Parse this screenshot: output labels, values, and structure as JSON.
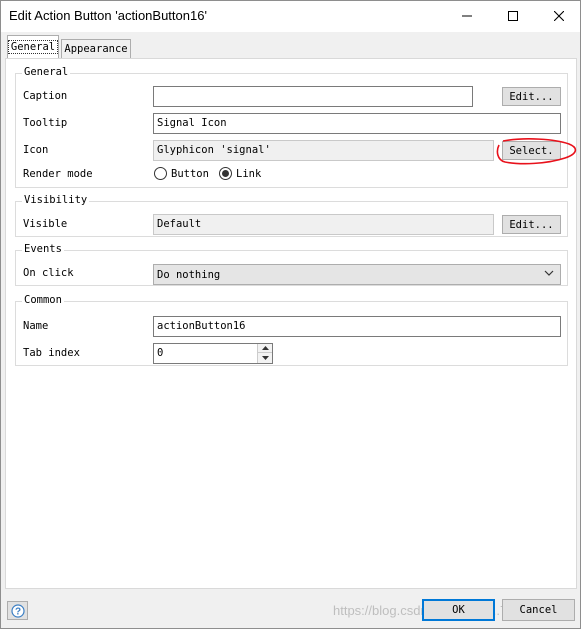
{
  "window": {
    "title": "Edit Action Button 'actionButton16'",
    "controls": [
      "minimize-icon",
      "maximize-icon",
      "close-icon"
    ]
  },
  "tabs": [
    {
      "label": "General",
      "active": true
    },
    {
      "label": "Appearance",
      "active": false
    }
  ],
  "general": {
    "title": "General",
    "caption_label": "Caption",
    "caption_value": "",
    "caption_button": "Edit...",
    "tooltip_label": "Tooltip",
    "tooltip_value": "Signal Icon",
    "icon_label": "Icon",
    "icon_value": "Glyphicon 'signal'",
    "icon_button": "Select.",
    "render_label": "Render mode",
    "render_options": [
      {
        "label": "Button",
        "checked": false
      },
      {
        "label": "Link",
        "checked": true
      }
    ]
  },
  "visibility": {
    "title": "Visibility",
    "visible_label": "Visible",
    "visible_value": "Default",
    "visible_button": "Edit..."
  },
  "events": {
    "title": "Events",
    "onclick_label": "On click",
    "onclick_value": "Do nothing"
  },
  "common": {
    "title": "Common",
    "name_label": "Name",
    "name_value": "actionButton16",
    "tabindex_label": "Tab index",
    "tabindex_value": "0"
  },
  "footer": {
    "ok": "OK",
    "cancel": "Cancel",
    "watermark": "https://blog.csdn.net/qq_39...7"
  },
  "colors": {
    "accent": "#0078d7",
    "annotation": "#e8111b",
    "dialog_bg": "#f0f0f0"
  }
}
